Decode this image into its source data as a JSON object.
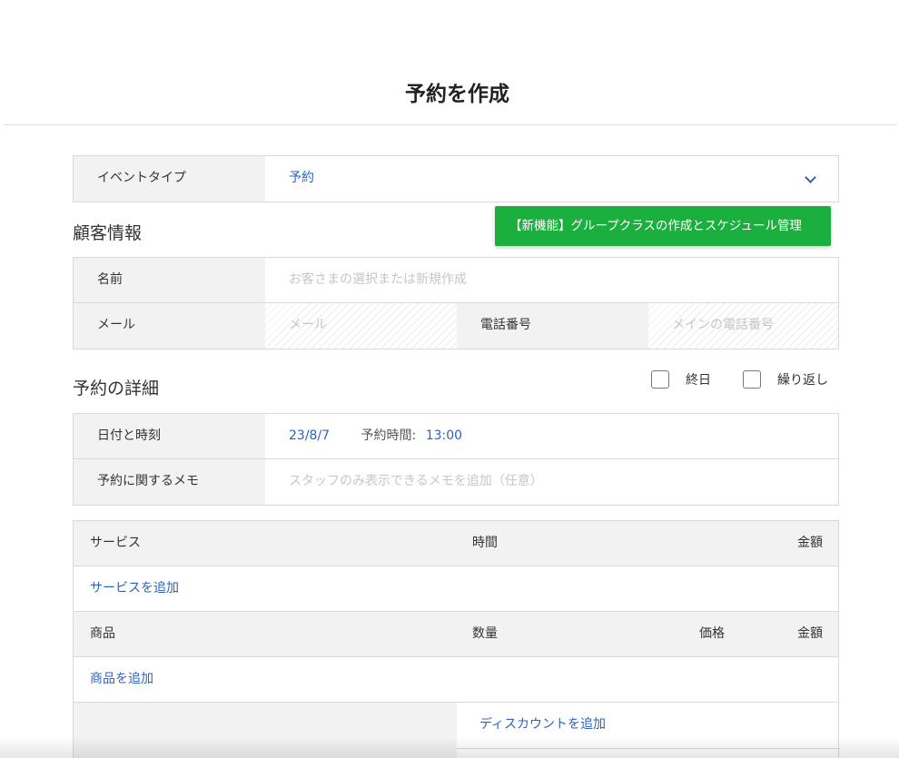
{
  "page_title": "予約を作成",
  "event_type": {
    "label": "イベントタイプ",
    "value": "予約"
  },
  "tooltip_text": "【新機能】グループクラスの作成とスケジュール管理",
  "customer_section": {
    "title": "顧客情報",
    "name_label": "名前",
    "name_placeholder": "お客さまの選択または新規作成",
    "email_label": "メール",
    "email_placeholder": "メール",
    "phone_label": "電話番号",
    "phone_placeholder": "メインの電話番号"
  },
  "details_section": {
    "title": "予約の詳細",
    "all_day_label": "終日",
    "repeat_label": "繰り返し",
    "datetime_label": "日付と時刻",
    "date_value": "23/8/7",
    "time_prefix": "予約時間:",
    "time_value": "13:00",
    "memo_label": "予約に関するメモ",
    "memo_placeholder": "スタッフのみ表示できるメモを追加（任意）"
  },
  "services_table": {
    "service_header": "サービス",
    "time_header": "時間",
    "amount_header": "金額",
    "add_service": "サービスを追加",
    "product_header": "商品",
    "quantity_header": "数量",
    "price_header": "価格",
    "amount_header2": "金額",
    "add_product": "商品を追加",
    "add_discount": "ディスカウントを追加"
  },
  "colors": {
    "accent_blue": "#2c63c1",
    "tooltip_green": "#1bb03e",
    "label_bg": "#f2f2f2",
    "border": "#d9d9d9"
  }
}
